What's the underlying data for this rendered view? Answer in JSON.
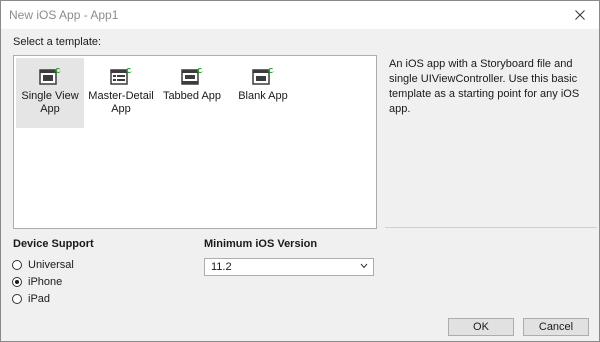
{
  "window": {
    "title": "New iOS App - App1"
  },
  "templates": {
    "label": "Select a template:",
    "items": [
      {
        "label": "Single View App",
        "icon": "single-view-template-icon",
        "selected": true
      },
      {
        "label": "Master-Detail App",
        "icon": "master-detail-template-icon",
        "selected": false
      },
      {
        "label": "Tabbed App",
        "icon": "tabbed-template-icon",
        "selected": false
      },
      {
        "label": "Blank App",
        "icon": "blank-template-icon",
        "selected": false
      }
    ],
    "description": "An iOS app with a Storyboard file and single UIViewController. Use this basic template as a starting point for any iOS app."
  },
  "device_support": {
    "label": "Device Support",
    "options": [
      {
        "label": "Universal",
        "checked": false
      },
      {
        "label": "iPhone",
        "checked": true
      },
      {
        "label": "iPad",
        "checked": false
      }
    ]
  },
  "min_ios": {
    "label": "Minimum iOS Version",
    "value": "11.2"
  },
  "buttons": {
    "ok": "OK",
    "cancel": "Cancel"
  },
  "colors": {
    "icon_dark": "#3c3c3c",
    "icon_accent": "#2a9d2a",
    "selection": "#e5e5e5"
  }
}
